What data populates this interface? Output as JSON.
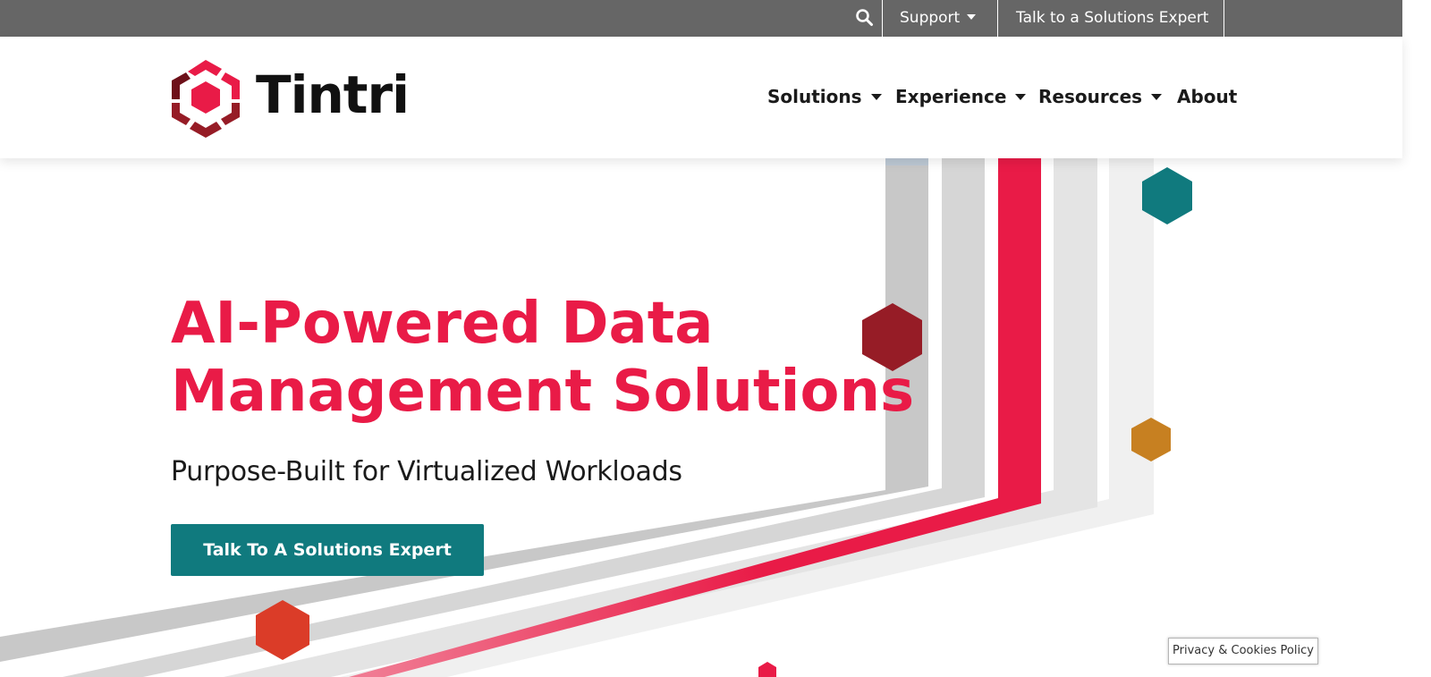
{
  "utility_bar": {
    "search_icon": "search-icon",
    "support_label": "Support",
    "expert_label": "Talk to a Solutions Expert"
  },
  "header": {
    "logo_text": "Tintri",
    "nav": [
      {
        "label": "Solutions",
        "has_dropdown": true
      },
      {
        "label": "Experience",
        "has_dropdown": true
      },
      {
        "label": "Resources",
        "has_dropdown": true
      },
      {
        "label": "About",
        "has_dropdown": false
      }
    ]
  },
  "hero": {
    "title_line1": "AI-Powered Data",
    "title_line2": "Management Solutions",
    "subtitle": "Purpose-Built for Virtualized Workloads",
    "cta_label": "Talk To A Solutions Expert"
  },
  "privacy": {
    "label": "Privacy & Cookies Policy"
  },
  "colors": {
    "brand_red": "#e91b47",
    "dark_red": "#961c26",
    "teal": "#107a7e",
    "amber": "#c78021",
    "orange_red": "#db3c28",
    "utility_gray": "#666666"
  }
}
